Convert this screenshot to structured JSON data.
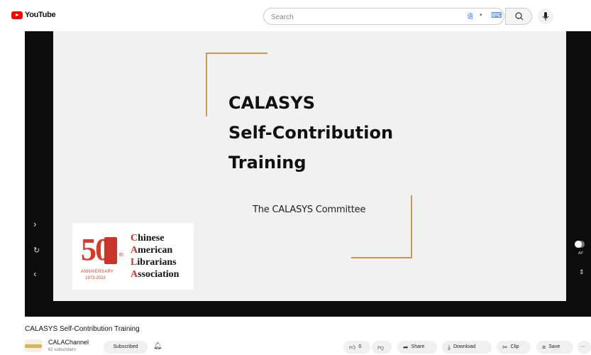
{
  "header": {
    "logo_text": "YouTube",
    "search_placeholder": "Search"
  },
  "slide": {
    "title_lines": [
      "CALASYS",
      "Self-Contribution",
      "Training"
    ],
    "committee": "The CALASYS Committee",
    "logo": {
      "number": "50",
      "suffix": "th",
      "anniversary": "ANNIVERSARY",
      "years": "1973-2023",
      "org_lines": [
        {
          "initial": "C",
          "rest": "hinese"
        },
        {
          "initial": "A",
          "rest": "merican"
        },
        {
          "initial": "L",
          "rest": "ibrarians"
        },
        {
          "initial": "A",
          "rest": "ssociation"
        }
      ]
    }
  },
  "player": {
    "autoplay_label": "AP"
  },
  "video": {
    "title": "CALASYS Self-Contribution Training",
    "channel_name": "CALAChannel",
    "subscribers": "62 subscribers",
    "subscribed_label": "Subscribed",
    "like_count": "0",
    "share_label": "Share",
    "download_label": "Download",
    "clip_label": "Clip",
    "save_label": "Save",
    "more_label": "···"
  },
  "colors": {
    "brand_red": "#ff0000",
    "frame_gold": "#c99a55",
    "cala_red": "#c8352a"
  }
}
